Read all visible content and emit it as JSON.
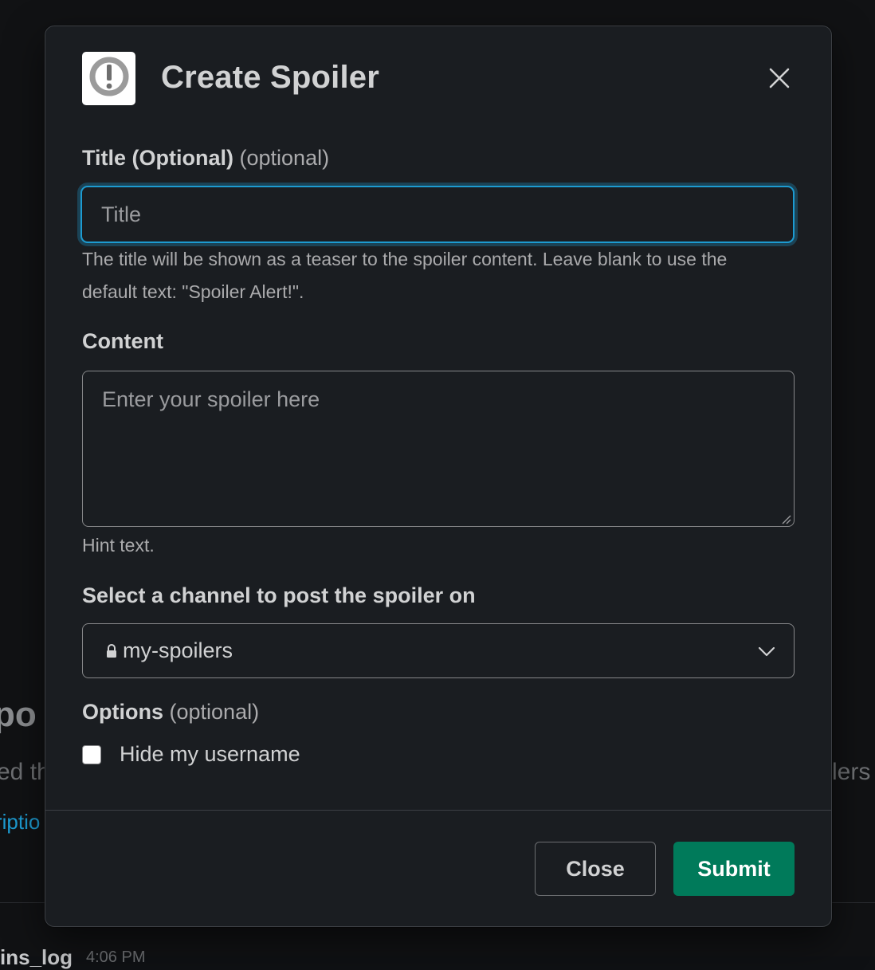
{
  "background": {
    "heading_fragment": "po",
    "line_fragment_left": "ed th",
    "line_fragment_right": "lers",
    "link_fragment": "riptio",
    "message_name_fragment": "ins_log",
    "message_time_fragment": "4:06 PM"
  },
  "modal": {
    "title": "Create Spoiler",
    "app_icon": "exclamation-circle-icon",
    "close_icon": "close-icon",
    "title_field": {
      "label": "Title (Optional)",
      "optional_tag": "(optional)",
      "placeholder": "Title",
      "value": "",
      "help_text": "The title will be shown as a teaser to the spoiler content. Leave blank to use the default text: \"Spoiler Alert!\"."
    },
    "content_field": {
      "label": "Content",
      "placeholder": "Enter your spoiler here",
      "value": "",
      "hint": "Hint text."
    },
    "channel_field": {
      "label": "Select a channel to post the spoiler on",
      "selected_value": "my-spoilers",
      "icon": "lock-icon"
    },
    "options_field": {
      "label": "Options",
      "optional_tag": "(optional)",
      "checkbox_label": "Hide my username",
      "checked": false
    },
    "buttons": {
      "close_label": "Close",
      "submit_label": "Submit"
    }
  },
  "colors": {
    "modal_bg": "#1a1d21",
    "focus_ring": "#1d9bd1",
    "submit_bg": "#007a5a",
    "text_primary": "#d1d2d3",
    "text_secondary": "#ababad"
  }
}
